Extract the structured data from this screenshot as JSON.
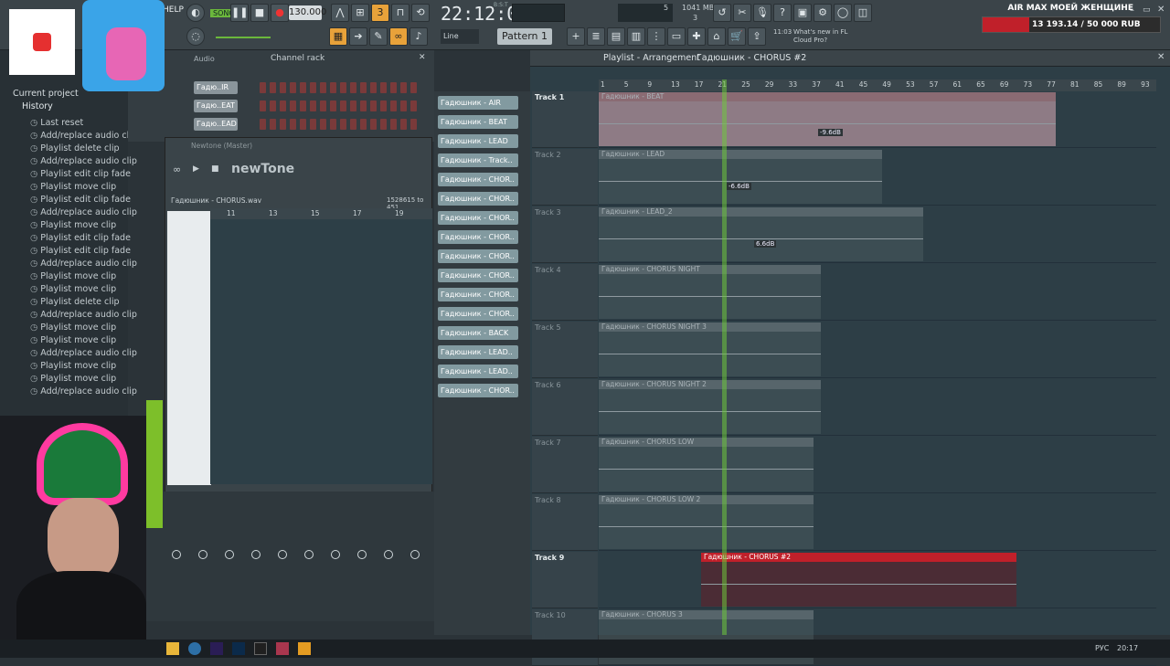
{
  "toolbar": {
    "help": "HELP",
    "song_mode": "SONG",
    "tempo": "130.000",
    "clock": "22:12:07",
    "clock_sub": "B:S:T",
    "memory": "1041 MB",
    "cpu": "5",
    "poly": "3",
    "pattern": "Pattern 1",
    "snap": "Line",
    "hint_time": "11:03",
    "hint_text": "What's new in FL Cloud Pro?"
  },
  "promo": {
    "title": "AIR MAX МОЕЙ ЖЕНЩИНЕ",
    "progress_text": "13 193.14 / 50 000 RUB",
    "progress": 0.264
  },
  "browser": {
    "current_project": "Current project",
    "history": "History",
    "items": [
      "Last reset",
      "Add/replace audio clip",
      "Playlist delete clip",
      "Add/replace audio clip",
      "Playlist edit clip fade",
      "Playlist move clip",
      "Playlist edit clip fade",
      "Add/replace audio clip",
      "Playlist move clip",
      "Playlist edit clip fade",
      "Playlist edit clip fade",
      "Add/replace audio clip",
      "Playlist move clip",
      "Playlist move clip",
      "Playlist delete clip",
      "Add/replace audio clip",
      "Playlist move clip",
      "Playlist move clip",
      "Add/replace audio clip",
      "Playlist move clip",
      "Playlist move clip",
      "Add/replace audio clip"
    ]
  },
  "channel_rack": {
    "title": "Channel rack",
    "filter": "Audio",
    "channels": [
      "Гадю..IR",
      "Гадю..EAT",
      "Гадю..EAD"
    ]
  },
  "newtone": {
    "window_title": "Newtone (Master)",
    "logo": "newTone",
    "file": "Гадюшник - CHORUS.wav",
    "range": "1528615 to 451",
    "ruler": [
      "11",
      "13",
      "15",
      "17",
      "19"
    ]
  },
  "picker": {
    "items": [
      "Гадюшник - AIR",
      "Гадюшник - BEAT",
      "Гадюшник - LEAD",
      "Гадюшник - Track..",
      "Гадюшник - CHOR..",
      "Гадюшник - CHOR..",
      "Гадюшник - CHOR..",
      "Гадюшник - CHOR..",
      "Гадюшник - CHOR..",
      "Гадюшник - CHOR..",
      "Гадюшник - CHOR..",
      "Гадюшник - CHOR..",
      "Гадюшник - BACK",
      "Гадюшник - LEAD..",
      "Гадюшник - LEAD..",
      "Гадюшник - CHOR.."
    ]
  },
  "playlist": {
    "title": "Playlist - Arrangement",
    "breadcrumb": "Гадюшник - CHORUS #2",
    "ruler": [
      "1",
      "5",
      "9",
      "13",
      "17",
      "21",
      "25",
      "29",
      "33",
      "37",
      "41",
      "45",
      "49",
      "53",
      "57",
      "61",
      "65",
      "69",
      "73",
      "77",
      "81",
      "85",
      "89",
      "93"
    ],
    "tracks": [
      {
        "name": "Track 1",
        "clip": "Гадюшник - BEAT",
        "gain": "-9.6dB"
      },
      {
        "name": "Track 2",
        "clip": "Гадюшник - LEAD",
        "gain": "-6.6dB"
      },
      {
        "name": "Track 3",
        "clip": "Гадюшник - LEAD_2",
        "gain": "6.6dB"
      },
      {
        "name": "Track 4",
        "clip": "Гадюшник - CHORUS NIGHT",
        "gain": ""
      },
      {
        "name": "Track 5",
        "clip": "Гадюшник - CHORUS NIGHT 3",
        "gain": ""
      },
      {
        "name": "Track 6",
        "clip": "Гадюшник - CHORUS NIGHT 2",
        "gain": ""
      },
      {
        "name": "Track 7",
        "clip": "Гадюшник - CHORUS LOW",
        "gain": ""
      },
      {
        "name": "Track 8",
        "clip": "Гадюшник - CHORUS LOW 2",
        "gain": ""
      },
      {
        "name": "Track 9",
        "clip": "Гадюшник - CHORUS #2",
        "gain": ""
      },
      {
        "name": "Track 10",
        "clip": "Гадюшник - CHORUS 3",
        "gain": ""
      }
    ]
  },
  "taskbar": {
    "lang": "РУС",
    "time": "20:17"
  },
  "colors": {
    "accent": "#e8a23a",
    "selected_clip": "#c0202a",
    "beat_clip": "#f0b8c4",
    "playhead": "#6ec83c"
  }
}
